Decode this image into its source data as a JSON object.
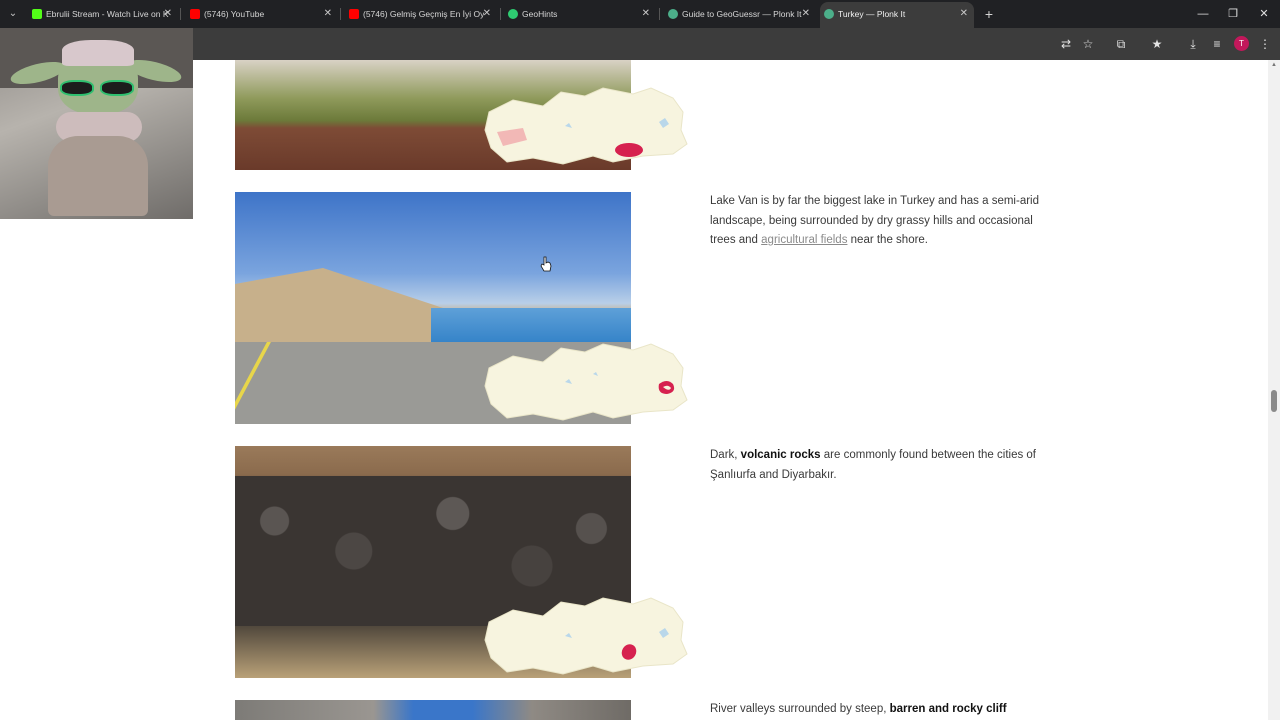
{
  "browser": {
    "tabs": [
      {
        "title": "Ebrulii Stream - Watch Live on K",
        "favicon_color": "#53fc18",
        "active": false
      },
      {
        "title": "(5746) YouTube",
        "favicon_color": "#ff0000",
        "active": false
      },
      {
        "title": "(5746) Gelmiş Geçmiş En İyi Oy",
        "favicon_color": "#ff0000",
        "active": false
      },
      {
        "title": "GeoHints",
        "favicon_color": "#2ecc71",
        "active": false
      },
      {
        "title": "Guide to GeoGuessr — Plonk It",
        "favicon_color": "#4caf8a",
        "active": false
      },
      {
        "title": "Turkey — Plonk It",
        "favicon_color": "#4caf8a",
        "active": true
      }
    ],
    "new_tab_symbol": "+",
    "window_controls": {
      "minimize": "—",
      "restore": "❐",
      "close": "✕"
    },
    "toolbar_icons": [
      "translate-icon",
      "star-icon",
      "extensions-icon",
      "bookmarks-icon",
      "download-icon",
      "media-icon",
      "menu-icon"
    ],
    "avatar_initial": "T"
  },
  "content": {
    "sections": [
      {
        "id": "lake-van",
        "parts": [
          {
            "text": "Lake Van is by far the biggest lake in Turkey and has a semi-arid landscape, being surrounded by dry grassy hills and occasional trees and ",
            "style": "normal"
          },
          {
            "text": "agricultural fields",
            "style": "link"
          },
          {
            "text": " near the shore.",
            "style": "normal"
          }
        ]
      },
      {
        "id": "volcanic-rocks",
        "parts": [
          {
            "text": "Dark, ",
            "style": "normal"
          },
          {
            "text": "volcanic rocks",
            "style": "bold"
          },
          {
            "text": " are commonly found between the cities of Şanlıurfa and Diyarbakır.",
            "style": "normal"
          }
        ]
      },
      {
        "id": "river-valleys",
        "parts": [
          {
            "text": "River valleys surrounded by steep, ",
            "style": "normal"
          },
          {
            "text": "barren and rocky cliff",
            "style": "bold"
          }
        ]
      }
    ]
  },
  "colors": {
    "map_land": "#f7f4df",
    "map_water": "#b9d7ea",
    "map_highlight": "#d6214f",
    "map_highlight_soft": "#f2b8b6"
  }
}
